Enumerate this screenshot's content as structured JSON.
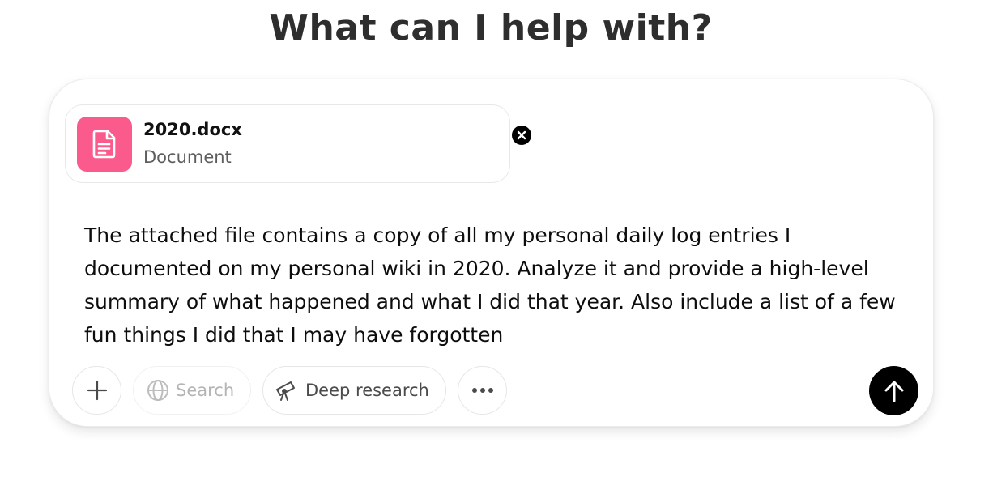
{
  "heading": "What can I help with?",
  "attachment": {
    "file_name": "2020.docx",
    "file_type": "Document",
    "icon": "document-icon",
    "icon_color": "#fb5a8d",
    "remove_icon": "close-icon"
  },
  "prompt": {
    "text": "The attached file contains a copy of all my personal daily log entries I documented on my personal wiki in 2020. Analyze it and provide a high-level summary of what happened and what I did that year. Also include a list of a few fun things I did that I may have forgotten"
  },
  "toolbar": {
    "add_icon": "plus-icon",
    "search_label": "Search",
    "search_icon": "globe-icon",
    "research_label": "Deep research",
    "research_icon": "telescope-icon",
    "more_icon": "more-dots-icon",
    "send_icon": "arrow-up-icon"
  }
}
